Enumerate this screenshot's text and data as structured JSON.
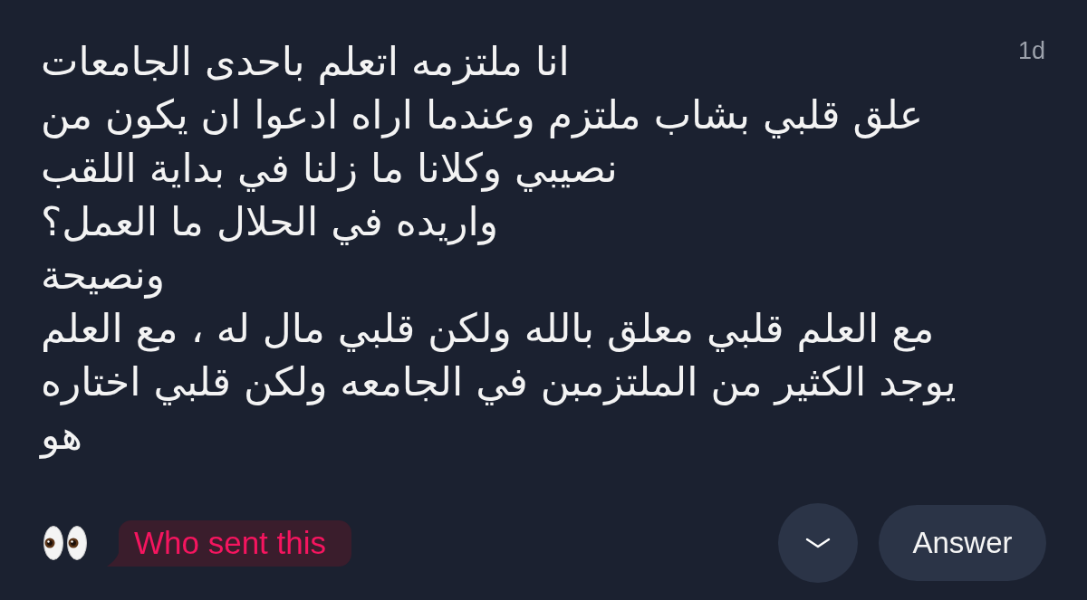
{
  "post": {
    "time": "1d",
    "message_lines": [
      "انا ملتزمه اتعلم باحدى الجامعات",
      "علق قلبي بشاب ملتزم وعندما اراه ادعوا ان يكون من",
      "نصيبي وكلانا ما زلنا في بداية اللقب",
      "واريده في الحلال ما العمل؟",
      "ونصيحة",
      "مع العلم قلبي معلق بالله ولكن قلبي مال له ، مع العلم",
      "يوجد الكثير من الملتزمبن في الجامعه ولكن قلبي اختاره",
      "هو"
    ]
  },
  "footer": {
    "who_sent_button": {
      "label": "Who sent this"
    },
    "answer_button": {
      "label": "Answer"
    }
  }
}
